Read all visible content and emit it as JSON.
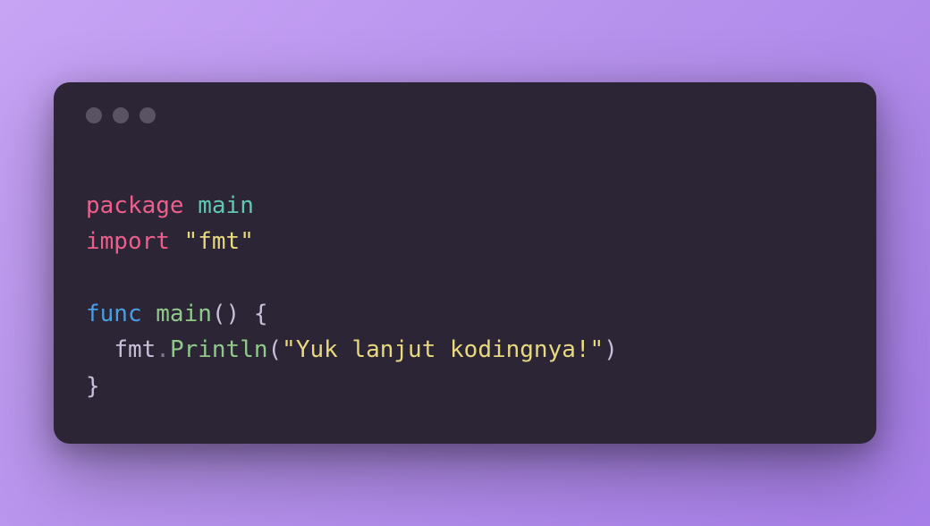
{
  "code": {
    "tokens": {
      "package": "package",
      "main": "main",
      "import": "import",
      "fmtLiteral": "\"fmt\"",
      "func": "func",
      "mainFn": "main",
      "parens": "()",
      "lbrace": " {",
      "indent": "  ",
      "fmt": "fmt",
      "dot": ".",
      "println": "Println",
      "lparen": "(",
      "stringArg": "\"Yuk lanjut kodingnya!\"",
      "rparen": ")",
      "rbrace": "}"
    }
  }
}
